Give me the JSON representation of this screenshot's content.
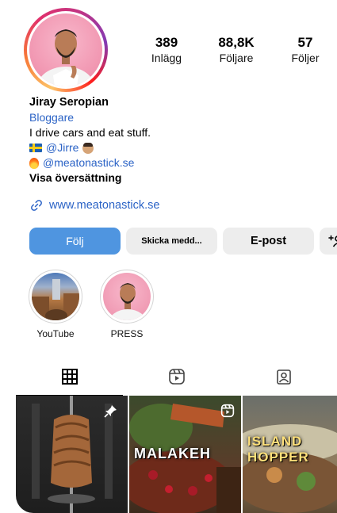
{
  "profile": {
    "name": "Jiray Seropian",
    "category": "Bloggare",
    "bio_line1": "I drive cars and eat stuff.",
    "handle_jirre": "@Jirre",
    "handle_meat": "@meatonastick.se",
    "translate": "Visa översättning",
    "website": "www.meatonastick.se"
  },
  "stats": {
    "posts_count": "389",
    "posts_label": "Inlägg",
    "followers_count": "88,8K",
    "followers_label": "Följare",
    "following_count": "57",
    "following_label": "Följer"
  },
  "actions": {
    "follow": "Följ",
    "message": "Skicka medd...",
    "email": "E-post"
  },
  "highlights": [
    {
      "label": "YouTube"
    },
    {
      "label": "PRESS"
    }
  ],
  "posts": [
    {
      "title": ""
    },
    {
      "title": "MALAKEH"
    },
    {
      "title": "ISLAND HOPPER"
    }
  ],
  "colors": {
    "accent_link": "#2b63c6",
    "follow_button": "#4f95e0",
    "secondary_button": "#ededed"
  }
}
